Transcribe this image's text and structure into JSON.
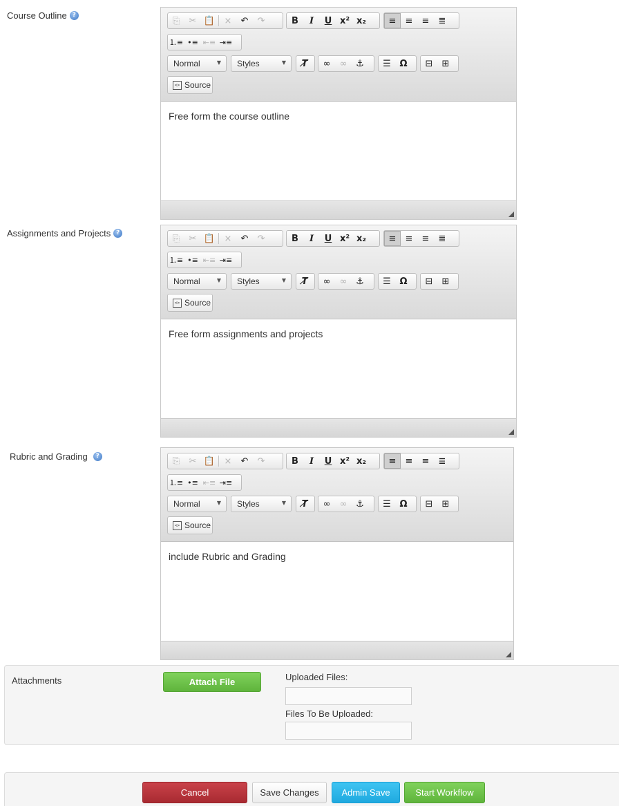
{
  "fields": [
    {
      "label": "Course Outline",
      "content": "Free form the course outline"
    },
    {
      "label": "Assignments and Projects",
      "content": "Free form assignments and projects"
    },
    {
      "label": "Rubric and Grading",
      "content": "include Rubric and Grading"
    }
  ],
  "toolbar": {
    "format_combo": "Normal",
    "styles_combo": "Styles",
    "source_label": "Source",
    "icons": [
      "copy-icon",
      "cut-icon",
      "paste-icon",
      "remove-format-x-icon",
      "undo-icon",
      "redo-icon",
      "bold-icon",
      "italic-icon",
      "underline-icon",
      "superscript-icon",
      "subscript-icon",
      "align-left-icon",
      "align-center-icon",
      "align-right-icon",
      "justify-icon",
      "numbered-list-icon",
      "bulleted-list-icon",
      "outdent-icon",
      "indent-icon",
      "remove-format-icon",
      "link-icon",
      "unlink-icon",
      "anchor-icon",
      "horizontal-rule-icon",
      "special-char-icon",
      "iframe-icon",
      "table-icon"
    ]
  },
  "attachments": {
    "label": "Attachments",
    "attach_button": "Attach File",
    "uploaded_label": "Uploaded Files:",
    "to_upload_label": "Files To Be Uploaded:"
  },
  "actions": {
    "cancel": "Cancel",
    "save_changes": "Save Changes",
    "admin_save": "Admin Save",
    "start_workflow": "Start Workflow"
  },
  "colors": {
    "cancel_bg": "#b8333a",
    "admin_save_bg": "#29b6ea",
    "start_workflow_bg": "#6cc04a",
    "attach_bg": "#6cc04a",
    "help_icon": "#3d78c6"
  }
}
